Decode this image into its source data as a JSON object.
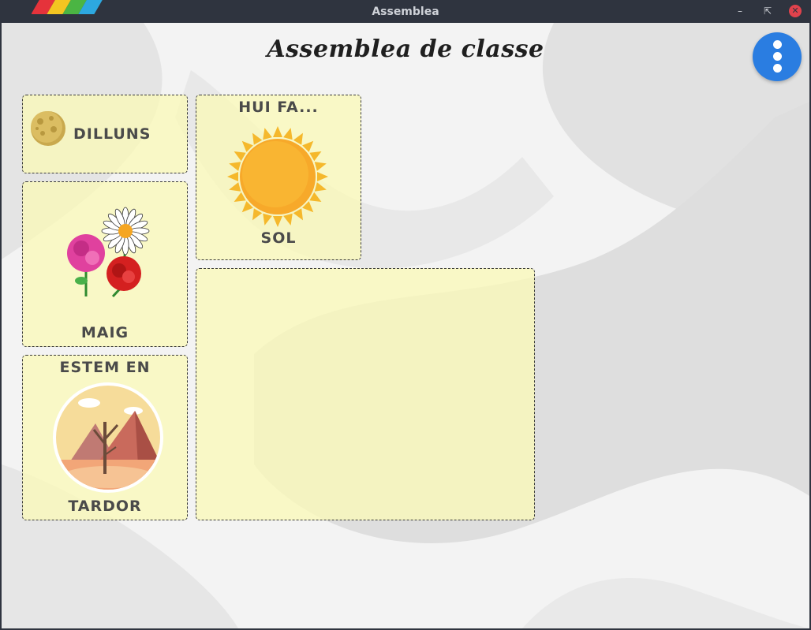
{
  "window": {
    "title": "Assemblea"
  },
  "header": {
    "title": "Assemblea de classe"
  },
  "menu": {
    "icon": "more-vertical-icon"
  },
  "cards": {
    "day": {
      "label": "DILLUNS",
      "icon": "moon-icon"
    },
    "weather": {
      "heading": "HUI FA...",
      "label": "SOL",
      "icon": "sun-icon"
    },
    "month": {
      "label": "MAIG",
      "icon": "flowers-icon"
    },
    "season": {
      "heading": "ESTEM EN",
      "label": "TARDOR",
      "icon": "autumn-landscape-icon"
    }
  },
  "colors": {
    "accent": "#2a7de1",
    "card_bg": "#faf8b9",
    "titlebar": "#2f343f"
  }
}
